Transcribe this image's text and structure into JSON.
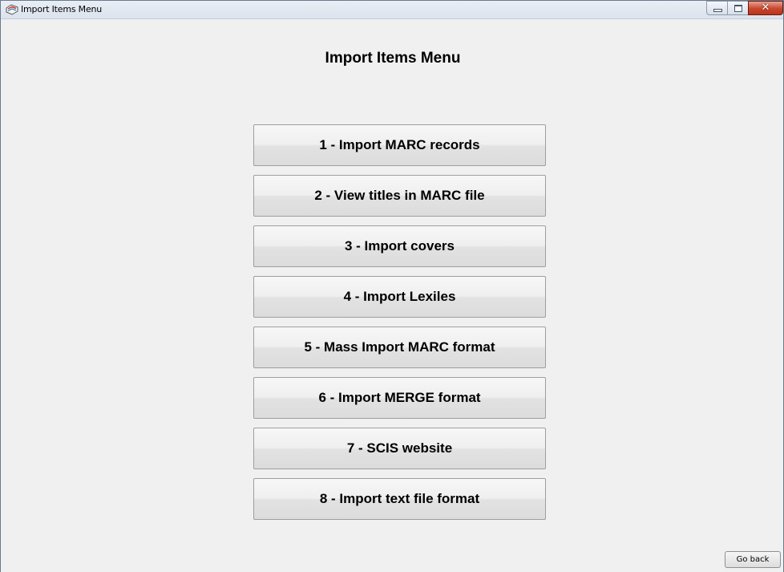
{
  "window": {
    "title": "Import Items Menu",
    "app_icon": "application-icon",
    "controls": {
      "minimize_icon": "minimize-icon",
      "maximize_icon": "maximize-icon",
      "close_icon": "close-icon",
      "close_glyph": "✕"
    }
  },
  "main": {
    "heading": "Import Items Menu",
    "buttons": [
      {
        "label": "1 - Import MARC records"
      },
      {
        "label": "2 - View titles in MARC file"
      },
      {
        "label": "3 - Import covers"
      },
      {
        "label": "4 - Import Lexiles"
      },
      {
        "label": "5 - Mass Import MARC format"
      },
      {
        "label": "6 - Import MERGE format"
      },
      {
        "label": "7 - SCIS website"
      },
      {
        "label": "8 - Import text file format"
      }
    ]
  },
  "footer": {
    "go_back_label": "Go back"
  },
  "colors": {
    "background": "#f0f0f0",
    "close_button": "#c9462c"
  }
}
